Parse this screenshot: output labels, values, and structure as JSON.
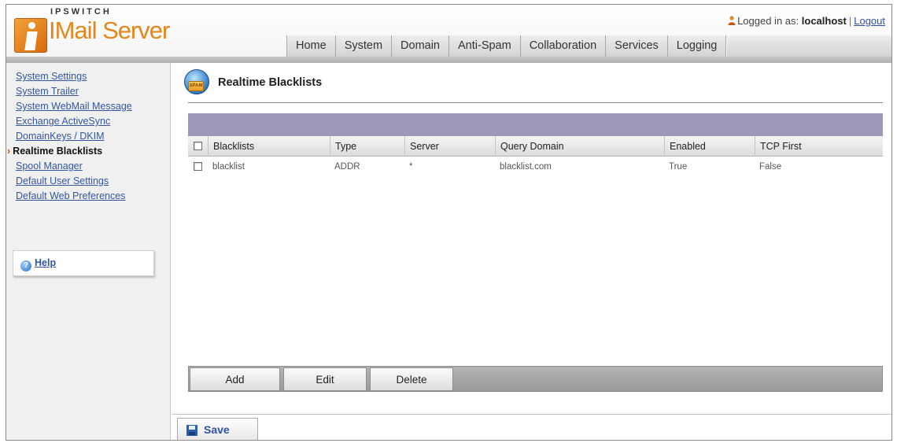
{
  "header": {
    "brand": "IPSWITCH",
    "product": "IMail Server",
    "user": {
      "prefix": "Logged in as:",
      "name": "localhost",
      "separator": "|",
      "logout": "Logout"
    },
    "nav": [
      "Home",
      "System",
      "Domain",
      "Anti-Spam",
      "Collaboration",
      "Services",
      "Logging"
    ]
  },
  "sidebar": {
    "items": [
      {
        "label": "System Settings"
      },
      {
        "label": "System Trailer"
      },
      {
        "label": "System WebMail Message"
      },
      {
        "label": "Exchange ActiveSync"
      },
      {
        "label": "DomainKeys / DKIM"
      },
      {
        "label": "Realtime Blacklists",
        "active": true,
        "marker": "›"
      },
      {
        "label": "Spool Manager"
      },
      {
        "label": "Default User Settings"
      },
      {
        "label": "Default Web Preferences"
      }
    ],
    "help": "Help"
  },
  "main": {
    "icon_text": "SPAM",
    "title": "Realtime Blacklists",
    "table": {
      "headers": [
        "Blacklists",
        "Type",
        "Server",
        "Query Domain",
        "Enabled",
        "TCP First"
      ],
      "rows": [
        [
          "blacklist",
          "ADDR",
          "*",
          "blacklist.com",
          "True",
          "False"
        ]
      ]
    },
    "buttons": {
      "add": "Add",
      "edit": "Edit",
      "delete": "Delete"
    },
    "save": "Save"
  },
  "colors": {
    "accent_orange": "#e4861c",
    "link_blue": "#3356a0",
    "table_band": "#9b98b8"
  }
}
